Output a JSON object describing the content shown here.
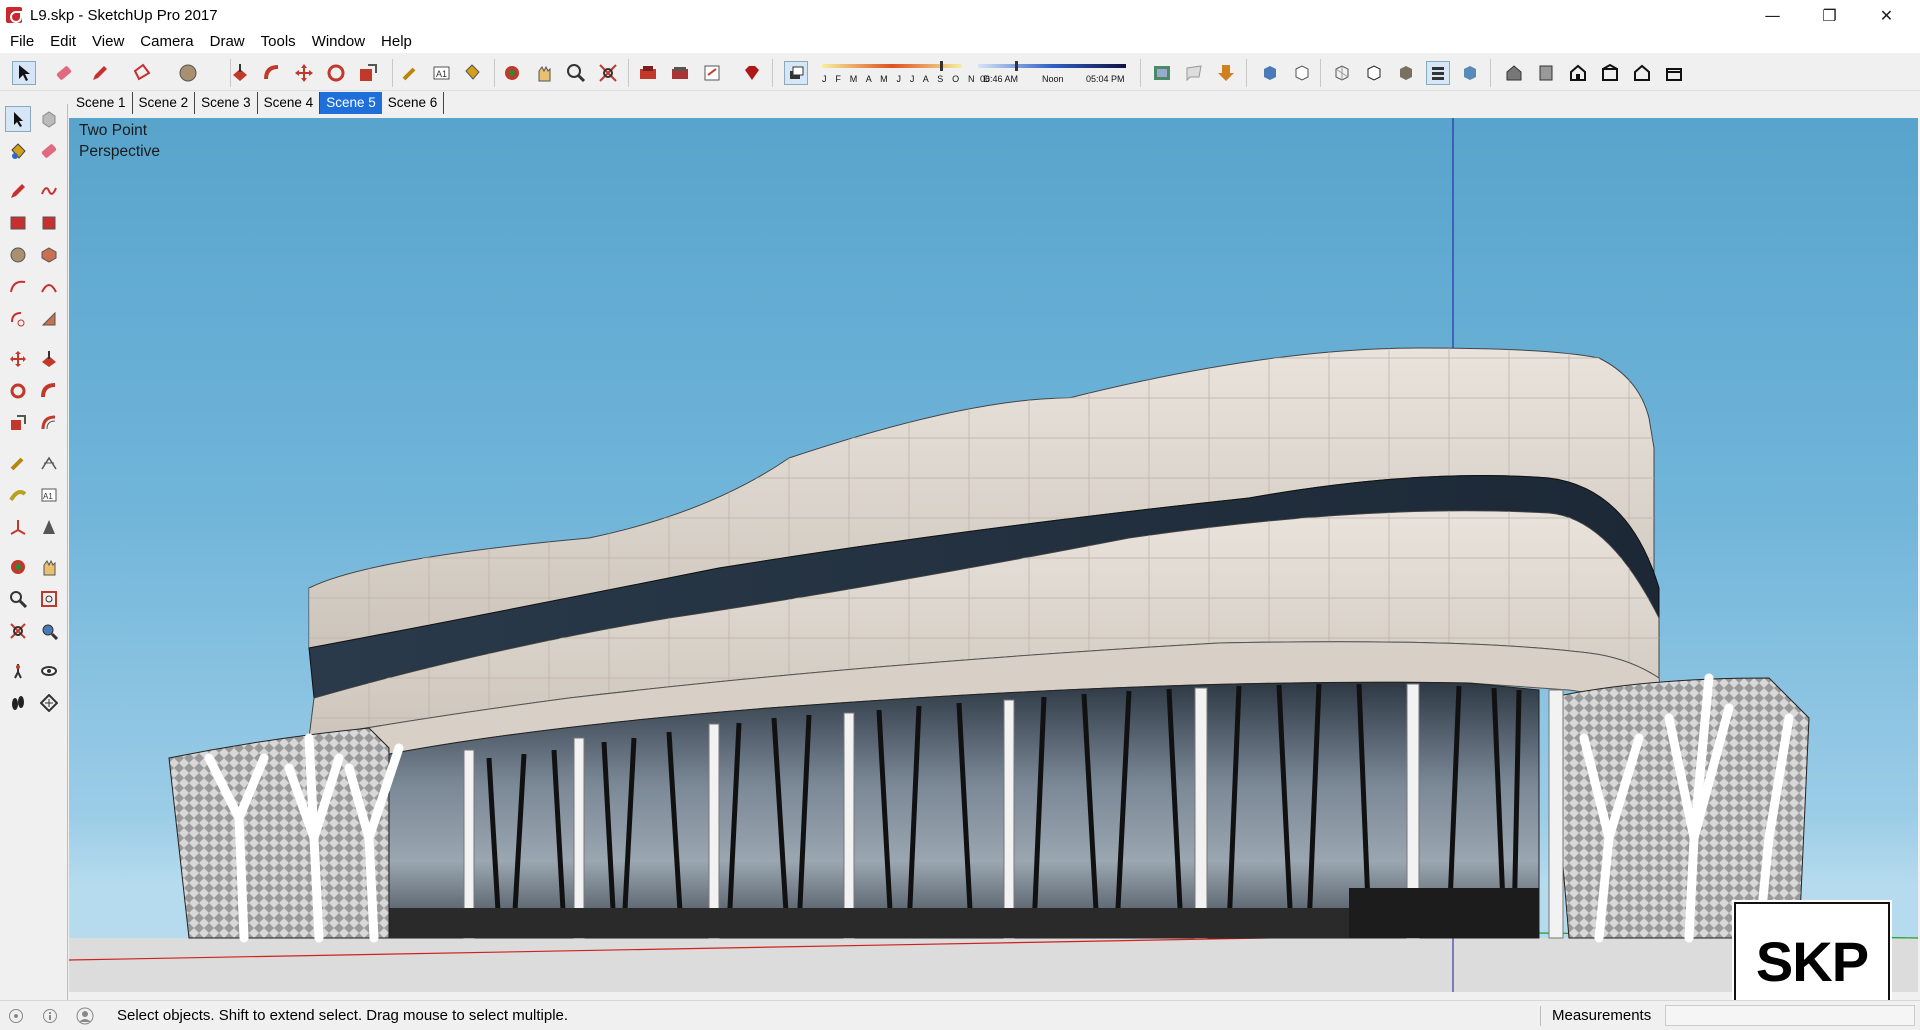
{
  "window": {
    "title": "L9.skp - SketchUp Pro 2017",
    "minimize_glyph": "—",
    "maximize_glyph": "❐",
    "close_glyph": "✕"
  },
  "menu": [
    "File",
    "Edit",
    "View",
    "Camera",
    "Draw",
    "Tools",
    "Window",
    "Help"
  ],
  "toolbar": {
    "icons": [
      "select-icon",
      "eraser-icon",
      "pencil-icon",
      "lasso-icon",
      "paint-cylinder-icon",
      "push-pull-icon",
      "follow-me-icon",
      "move-icon",
      "rotate-icon",
      "scale-icon",
      "tape-measure-icon",
      "text-icon",
      "paint-bucket-icon",
      "orbit-icon",
      "pan-icon",
      "zoom-icon",
      "zoom-extents-icon",
      "warehouse-icon",
      "extension-icon",
      "send-layout-icon",
      "ruby-gem-icon"
    ],
    "shadow_months": "J F M A M J J A S O N D",
    "shadow_time_start": "06:46 AM",
    "shadow_time_mid": "Noon",
    "shadow_time_end": "05:04 PM",
    "view_icons": [
      "map-icon",
      "speech-bubble-icon",
      "download-icon",
      "iso-icon",
      "wireframe-icon",
      "xray-icon",
      "hidden-line-icon",
      "shaded-icon",
      "textured-icon",
      "monochrome-icon",
      "house-iso-icon",
      "house-top-icon",
      "house-front-icon",
      "house-right-icon",
      "house-back-icon",
      "house-left-icon"
    ]
  },
  "scenes": {
    "tabs": [
      "Scene 1",
      "Scene 2",
      "Scene 3",
      "Scene 4",
      "Scene 5",
      "Scene 6"
    ],
    "active": "Scene 5"
  },
  "palette": [
    "select-icon",
    "component-icon",
    "paint-bucket-icon",
    "eraser-icon",
    "pencil-icon",
    "freehand-icon",
    "rectangle-icon",
    "rotated-rectangle-icon",
    "circle-icon",
    "polygon-icon",
    "arc-icon",
    "two-point-arc-icon",
    "three-point-arc-icon",
    "pie-icon",
    "move-icon",
    "push-pull-icon",
    "rotate-icon",
    "follow-me-icon",
    "scale-icon",
    "offset-icon",
    "tape-measure-icon",
    "dimension-icon",
    "protractor-icon",
    "text-icon",
    "axes-icon",
    "3d-text-icon",
    "orbit-icon",
    "pan-icon",
    "zoom-icon",
    "zoom-window-icon",
    "zoom-extents-icon",
    "previous-view-icon",
    "position-camera-icon",
    "look-around-icon",
    "walk-icon",
    "section-plane-icon"
  ],
  "viewport": {
    "camera_label_line1": "Two Point",
    "camera_label_line2": "Perspective"
  },
  "status": {
    "message": "Select objects. Shift to extend select. Drag mouse to select multiple.",
    "measurements_label": "Measurements",
    "measurements_value": ""
  },
  "badge": {
    "text": "SKP"
  },
  "colors": {
    "active_tab": "#1e6fd9",
    "sky_top": "#58a4cc",
    "sky_bottom": "#b7dbee",
    "facade": "#ddd6cf",
    "glass": "#4b5b6a",
    "red_axis": "#d02020",
    "blue_axis": "#1a1aa0",
    "green_axis": "#20a020"
  }
}
